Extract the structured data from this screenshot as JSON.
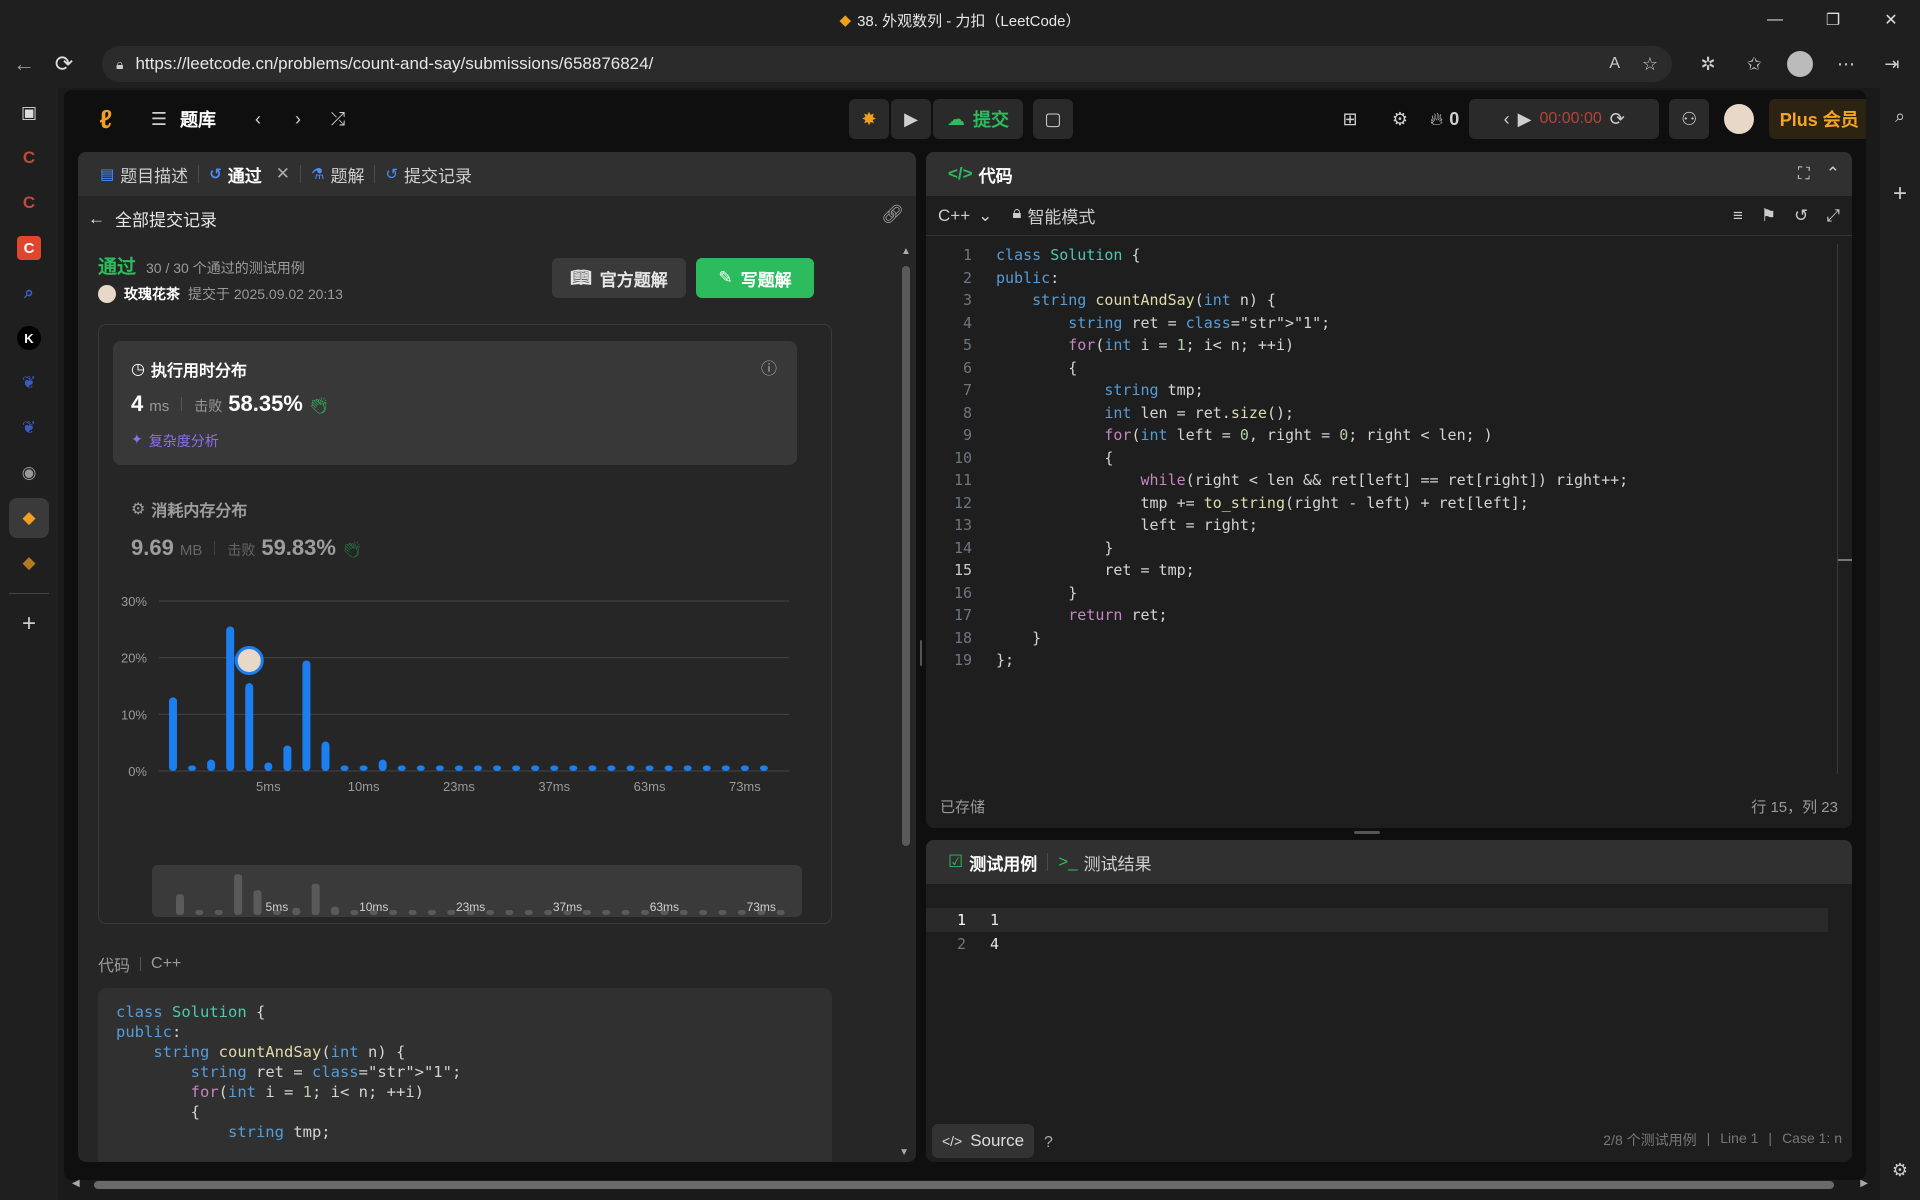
{
  "window": {
    "title": "38. 外观数列 - 力扣（LeetCode）"
  },
  "browser": {
    "url": "https://leetcode.cn/problems/count-and-say/submissions/658876824/",
    "sidebar_letters": [
      "C",
      "C",
      "C",
      "K"
    ]
  },
  "app": {
    "problem_bank": "题库",
    "submit_label": "提交",
    "streak_count": "0",
    "timer": "00:00:00",
    "plus_label": "Plus 会员"
  },
  "left_panel": {
    "tabs": [
      "题目描述",
      "通过",
      "题解",
      "提交记录"
    ],
    "back_label": "全部提交记录",
    "status": "通过",
    "passed_cases": "30 / 30 个通过的测试用例",
    "username": "玫瑰花茶",
    "submitted_at": "提交于 2025.09.02 20:13",
    "official_solution": "官方题解",
    "write_solution": "写题解",
    "runtime": {
      "title": "执行用时分布",
      "value": "4",
      "unit": "ms",
      "beats_label": "击败",
      "beats": "58.35%",
      "complexity": "复杂度分析"
    },
    "memory": {
      "title": "消耗内存分布",
      "value": "9.69",
      "unit": "MB",
      "beats_label": "击败",
      "beats": "59.83%"
    },
    "code_label": "代码",
    "lang_label": "C++"
  },
  "chart_data": {
    "type": "bar",
    "title": "",
    "ylabel": "",
    "xlabel": "",
    "ylim": [
      0,
      30
    ],
    "y_ticks": [
      "30%",
      "20%",
      "10%",
      "0%"
    ],
    "x_ticks": [
      "5ms",
      "10ms",
      "23ms",
      "37ms",
      "63ms",
      "73ms"
    ],
    "values": [
      13,
      1,
      2,
      25.5,
      15.5,
      1.5,
      4.5,
      19.5,
      5.2,
      1,
      1,
      2,
      1,
      1,
      1,
      1,
      1,
      1,
      1,
      1,
      1,
      1,
      1,
      1,
      1,
      1,
      1,
      1,
      1,
      1,
      1,
      1
    ],
    "highlight_index": 4,
    "unit": "%"
  },
  "editor": {
    "title": "代码",
    "language": "C++",
    "mode": "智能模式",
    "saved": "已存储",
    "cursor": "行 15，列 23",
    "current_line": 15
  },
  "code_lines": [
    "class Solution {",
    "public:",
    "    string countAndSay(int n) {",
    "        string ret = \"1\";",
    "        for(int i = 1; i< n; ++i)",
    "        {",
    "            string tmp;",
    "            int len = ret.size();",
    "            for(int left = 0, right = 0; right < len; )",
    "            {",
    "                while(right < len && ret[left] == ret[right]) right++;",
    "                tmp += to_string(right - left) + ret[left];",
    "                left = right;",
    "            }",
    "            ret = tmp;",
    "        }",
    "        return ret;",
    "    }",
    "};"
  ],
  "testcase": {
    "tab_cases": "测试用例",
    "tab_results": "测试结果",
    "inputs": [
      "1",
      "4"
    ],
    "source_label": "Source",
    "footer_cases": "2/8 个测试用例",
    "footer_line": "Line 1",
    "footer_case": "Case 1: n"
  }
}
